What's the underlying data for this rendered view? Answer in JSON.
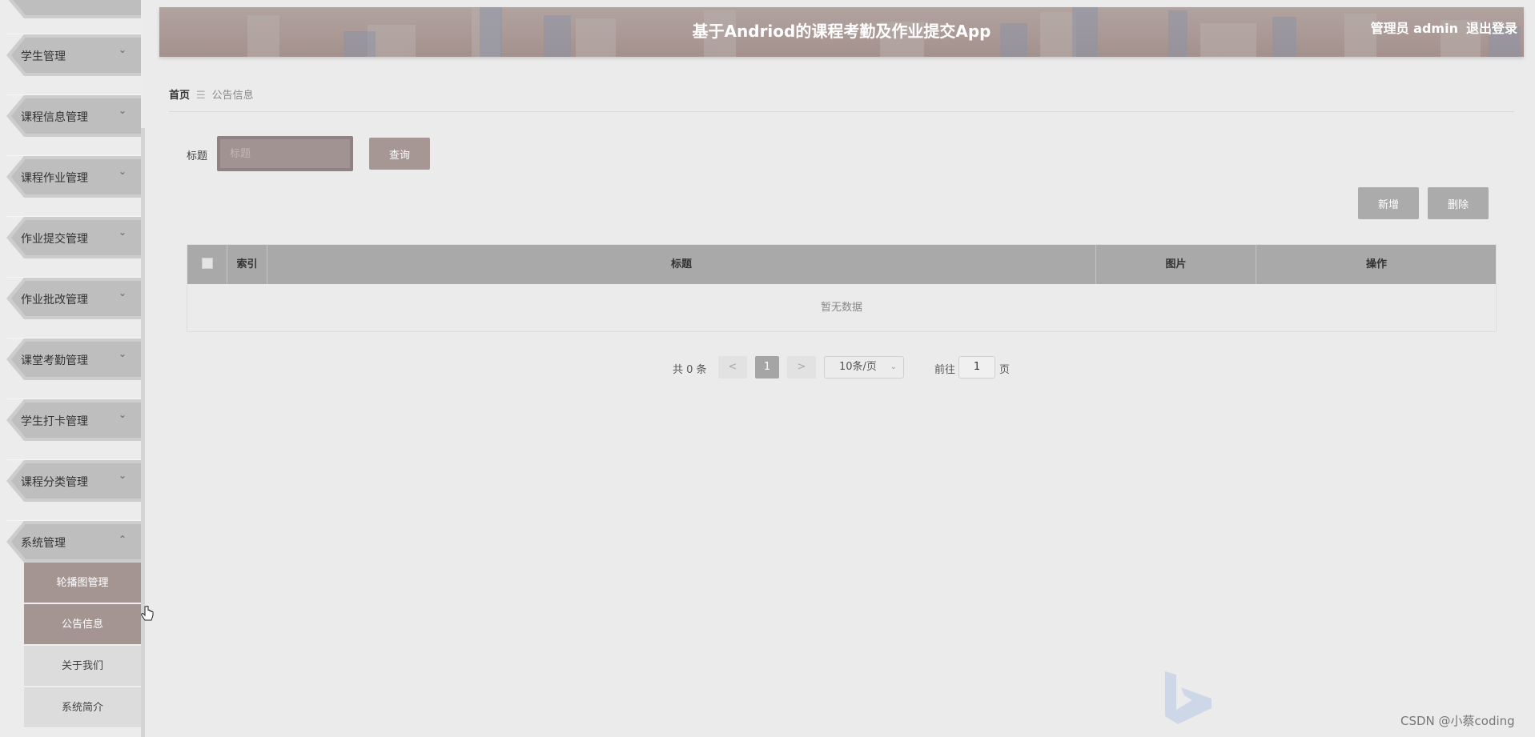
{
  "sidebar": {
    "items": [
      {
        "label": "学生管理"
      },
      {
        "label": "课程信息管理"
      },
      {
        "label": "课程作业管理"
      },
      {
        "label": "作业提交管理"
      },
      {
        "label": "作业批改管理"
      },
      {
        "label": "课堂考勤管理"
      },
      {
        "label": "学生打卡管理"
      },
      {
        "label": "课程分类管理"
      },
      {
        "label": "系统管理"
      }
    ],
    "submenu": [
      {
        "label": "轮播图管理"
      },
      {
        "label": "公告信息"
      },
      {
        "label": "关于我们"
      },
      {
        "label": "系统简介"
      }
    ],
    "icons": {
      "collapsed": "chevron-down-icon",
      "expanded": "chevron-up-icon"
    }
  },
  "header": {
    "title": "基于Andriod的课程考勤及作业提交App",
    "user": "管理员 admin",
    "logout": "退出登录"
  },
  "breadcrumb": {
    "home": "首页",
    "separator": "☰",
    "current": "公告信息"
  },
  "search": {
    "label": "标题",
    "placeholder": "标题",
    "query_button": "查询"
  },
  "actions": {
    "add_button": "新增",
    "delete_button": "删除"
  },
  "table": {
    "columns": [
      "索引",
      "标题",
      "图片",
      "操作"
    ],
    "empty_text": "暂无数据"
  },
  "pagination": {
    "total_text": "共 0 条",
    "prev": "<",
    "current_page": "1",
    "next": ">",
    "page_size": "10条/页",
    "goto_label": "前往",
    "goto_value": "1",
    "goto_unit": "页"
  },
  "watermark": "CSDN @小蔡coding",
  "colors": {
    "accent": "#a49593",
    "header_bg": "#a4918d",
    "table_header": "#a9a9a9"
  }
}
